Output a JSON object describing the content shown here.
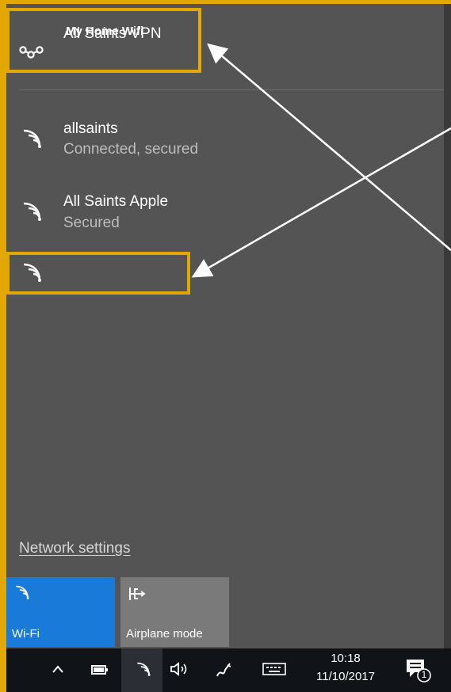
{
  "vpn": {
    "label": "All Saints VPN",
    "icon": "vpn-icon"
  },
  "networks": [
    {
      "name": "allsaints",
      "status": "Connected, secured",
      "icon": "wifi-signal-icon"
    },
    {
      "name": "All Saints Apple",
      "status": "Secured",
      "icon": "wifi-signal-icon"
    },
    {
      "name": "My Home Wifi",
      "status": "",
      "icon": "wifi-signal-icon"
    }
  ],
  "network_settings": "Network settings",
  "quick_actions": [
    {
      "label": "Wi-Fi",
      "icon": "wifi-icon",
      "active": true
    },
    {
      "label": "Airplane mode",
      "icon": "airplane-icon",
      "active": false
    }
  ],
  "taskbar": {
    "time": "10:18",
    "date": "11/10/2017",
    "notification_count": "1"
  },
  "colors": {
    "highlight": "#e3a800",
    "panel": "#545454",
    "accent": "#1a7ad9",
    "taskbar": "#101317"
  }
}
